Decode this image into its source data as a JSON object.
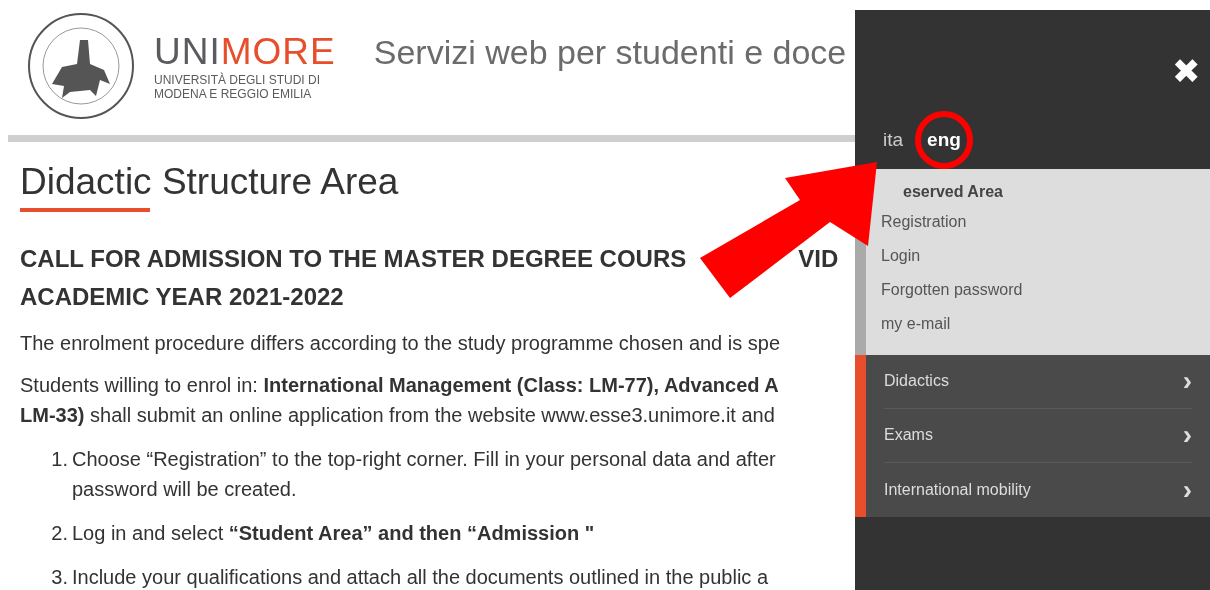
{
  "header": {
    "brand": [
      "UNI",
      "MORE"
    ],
    "brand_subtitle": [
      "UNIVERSITÀ DEGLI STUDI DI",
      "MODENA E REGGIO EMILIA"
    ],
    "tagline": "Servizi web per studenti e doce"
  },
  "page": {
    "title": "Didactic Structure Area",
    "heading": [
      [
        "CALL FOR ADMISSION TO THE MASTER DEGREE COURS",
        "VID"
      ],
      [
        "ACADEMIC YEAR 2021-2022"
      ]
    ],
    "paragraphs": [
      [
        "The enrolment procedure differs according to the study programme chosen and is spe"
      ],
      [
        "Students willing to enrol in: **International Management (Class: LM-77), Advanced A**",
        "**LM-33)** shall submit an online application from the website www.esse3.unimore.it and"
      ]
    ],
    "steps": [
      {
        "number": "1.",
        "lines": [
          "Choose “Registration” to the top-right corner. Fill in your personal data and after",
          "password will be created."
        ]
      },
      {
        "number": "2.",
        "lines": [
          "Log in and select **“Student Area” and then “Admission \"**"
        ]
      },
      {
        "number": "3.",
        "lines": [
          "Include your qualifications and attach all the documents outlined in the public a"
        ]
      }
    ]
  },
  "side_panel": {
    "close": "✖",
    "languages": [
      {
        "label": "ita",
        "selected": false
      },
      {
        "label": "eng",
        "selected": true
      }
    ],
    "reserved_area": {
      "title": "eserved Area",
      "links": [
        "Registration",
        "Login",
        "Forgotten password",
        "my e-mail"
      ]
    },
    "menu": [
      {
        "label": "Didactics",
        "chevron": "›"
      },
      {
        "label": "Exams",
        "chevron": "›"
      },
      {
        "label": "International mobility",
        "chevron": "›"
      }
    ]
  }
}
